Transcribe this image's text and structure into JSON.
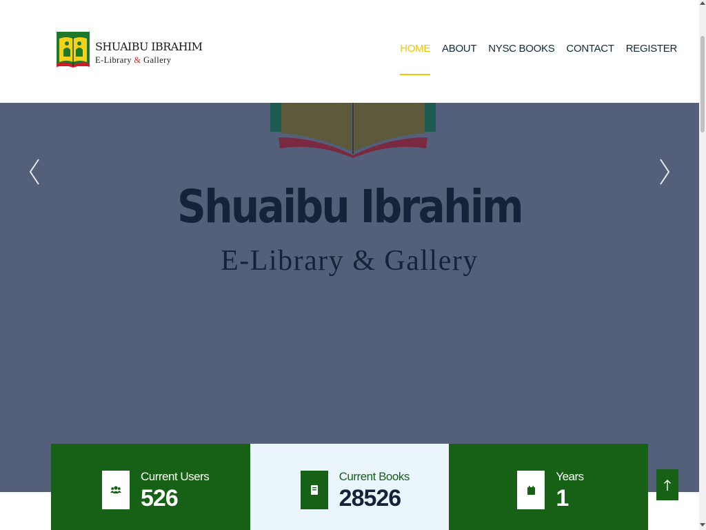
{
  "header": {
    "logo": {
      "title": "SHUAIBU IBRAHIM",
      "subtitle_part1": "E-Library ",
      "subtitle_amp": "&",
      "subtitle_part2": " Gallery",
      "icon": "open-book-logo-icon"
    },
    "nav": [
      {
        "label": "HOME",
        "active": true
      },
      {
        "label": "ABOUT",
        "active": false
      },
      {
        "label": "NYSC BOOKS",
        "active": false
      },
      {
        "label": "CONTACT",
        "active": false
      },
      {
        "label": "REGISTER",
        "active": false
      }
    ]
  },
  "hero": {
    "title": "Shuaibu Ibrahim",
    "subtitle": "E-Library & Gallery",
    "prev_icon": "chevron-left-icon",
    "next_icon": "chevron-right-icon"
  },
  "stats": [
    {
      "label": "Current Users",
      "value": "526",
      "icon": "users-icon"
    },
    {
      "label": "Current Books",
      "value": "28526",
      "icon": "book-icon"
    },
    {
      "label": "Years",
      "value": "1",
      "icon": "calendar-icon"
    }
  ],
  "back_to_top_icon": "arrow-up-icon",
  "colors": {
    "primary_green": "#176117",
    "accent_yellow": "#f5c500",
    "hero_bg": "#546079",
    "navy_text": "#15223a",
    "light_card": "#eaf6fb"
  }
}
